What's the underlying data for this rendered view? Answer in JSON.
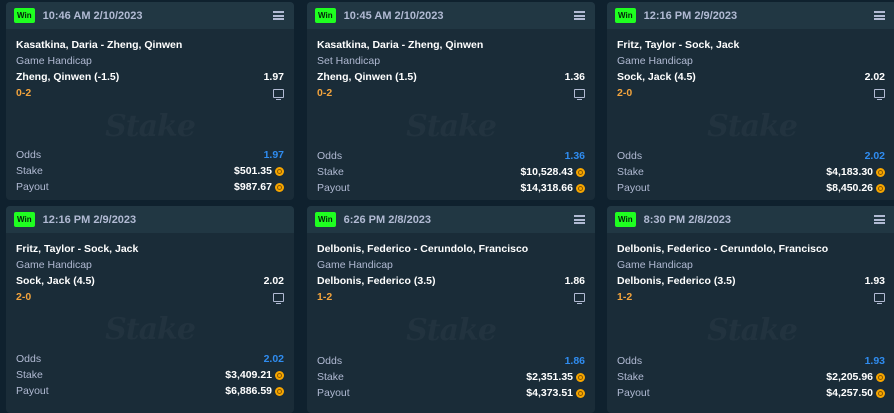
{
  "win_label": "Win",
  "watermark": "Stake",
  "labels": {
    "odds": "Odds",
    "stake": "Stake",
    "payout": "Payout"
  },
  "colors": {
    "win": "#1fff20",
    "score": "#f2a33c",
    "odds": "#2f8cf0",
    "coin": "#f7a600"
  },
  "cards": [
    {
      "time": "10:46 AM 2/10/2023",
      "match": "Kasatkina, Daria - Zheng, Qinwen",
      "market": "Game Handicap",
      "selection": "Zheng, Qinwen (-1.5)",
      "selection_odds": "1.97",
      "score": "0-2",
      "odds": "1.97",
      "stake": "$501.35",
      "payout": "$987.67"
    },
    {
      "time": "10:45 AM 2/10/2023",
      "match": "Kasatkina, Daria - Zheng, Qinwen",
      "market": "Set Handicap",
      "selection": "Zheng, Qinwen (1.5)",
      "selection_odds": "1.36",
      "score": "0-2",
      "odds": "1.36",
      "stake": "$10,528.43",
      "payout": "$14,318.66"
    },
    {
      "time": "12:16 PM 2/9/2023",
      "match": "Fritz, Taylor - Sock, Jack",
      "market": "Game Handicap",
      "selection": "Sock, Jack (4.5)",
      "selection_odds": "2.02",
      "score": "2-0",
      "odds": "2.02",
      "stake": "$4,183.30",
      "payout": "$8,450.26"
    },
    {
      "time": "12:16 PM 2/9/2023",
      "match": "Fritz, Taylor - Sock, Jack",
      "market": "Game Handicap",
      "selection": "Sock, Jack (4.5)",
      "selection_odds": "2.02",
      "score": "2-0",
      "odds": "2.02",
      "stake": "$3,409.21",
      "payout": "$6,886.59"
    },
    {
      "time": "6:26 PM 2/8/2023",
      "match": "Delbonis, Federico - Cerundolo, Francisco",
      "market": "Game Handicap",
      "selection": "Delbonis, Federico (3.5)",
      "selection_odds": "1.86",
      "score": "1-2",
      "odds": "1.86",
      "stake": "$2,351.35",
      "payout": "$4,373.51"
    },
    {
      "time": "8:30 PM 2/8/2023",
      "match": "Delbonis, Federico - Cerundolo, Francisco",
      "market": "Game Handicap",
      "selection": "Delbonis, Federico (3.5)",
      "selection_odds": "1.93",
      "score": "1-2",
      "odds": "1.93",
      "stake": "$2,205.96",
      "payout": "$4,257.50"
    }
  ]
}
